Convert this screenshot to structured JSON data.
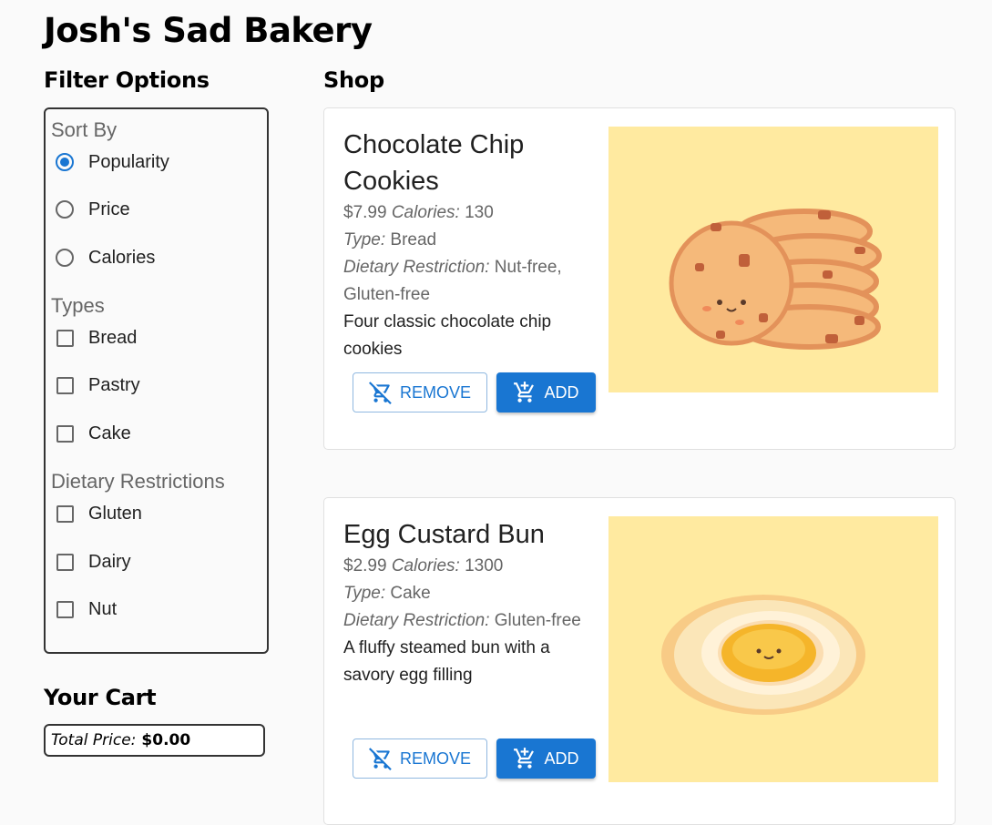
{
  "app": {
    "title": "Josh's Sad Bakery"
  },
  "filters": {
    "heading": "Filter Options",
    "sort": {
      "label": "Sort By",
      "options": [
        "Popularity",
        "Price",
        "Calories"
      ],
      "selected": "Popularity"
    },
    "types": {
      "label": "Types",
      "options": [
        "Bread",
        "Pastry",
        "Cake"
      ]
    },
    "dietary": {
      "label": "Dietary Restrictions",
      "options": [
        "Gluten",
        "Dairy",
        "Nut"
      ]
    }
  },
  "cart": {
    "heading": "Your Cart",
    "total_label": "Total Price:",
    "total_value": "$0.00"
  },
  "shop": {
    "heading": "Shop",
    "calories_label": "Calories:",
    "type_label": "Type:",
    "diet_label": "Dietary Restriction:",
    "remove_label": "REMOVE",
    "add_label": "ADD",
    "items": [
      {
        "name": "Chocolate Chip Cookies",
        "price": "$7.99",
        "calories": "130",
        "type": "Bread",
        "diet": "Nut-free, Gluten-free",
        "description": "Four classic chocolate chip cookies",
        "image_icon": "cookies-illustration"
      },
      {
        "name": "Egg Custard Bun",
        "price": "$2.99",
        "calories": "1300",
        "type": "Cake",
        "diet": "Gluten-free",
        "description": "A fluffy steamed bun with a savory egg filling",
        "image_icon": "egg-custard-bun-illustration"
      }
    ]
  },
  "colors": {
    "primary": "#1976d2",
    "image_bg": "#ffeaa0"
  }
}
